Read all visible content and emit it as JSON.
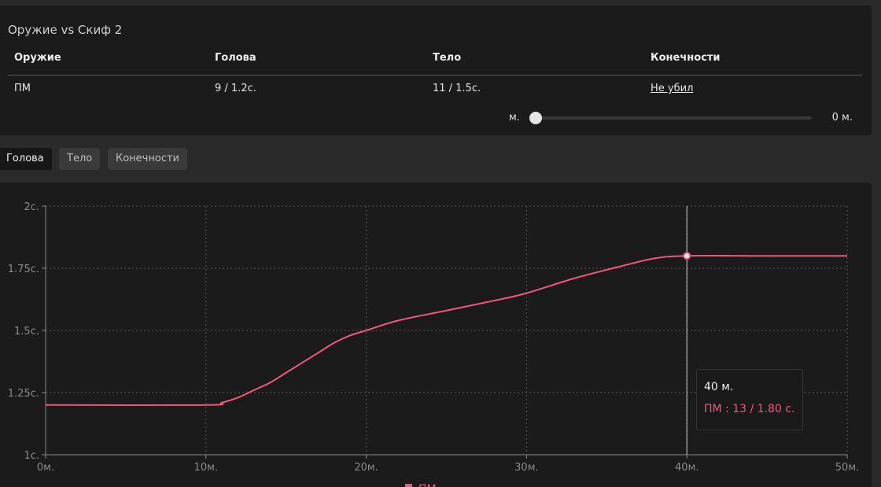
{
  "card": {
    "title": "Оружие vs Скиф 2",
    "headers": [
      "Оружие",
      "Голова",
      "Тело",
      "Конечности"
    ],
    "row": {
      "weapon": "ПМ",
      "head": "9 / 1.2с.",
      "body": "11 / 1.5с.",
      "limbs": "Не убил"
    },
    "slider": {
      "unit": "м.",
      "value_text": "0 м.",
      "value": 0
    }
  },
  "tabs": [
    {
      "label": "Голова",
      "active": true
    },
    {
      "label": "Тело",
      "active": false
    },
    {
      "label": "Конечности",
      "active": false
    }
  ],
  "colors": {
    "series": "#f0587a",
    "grid": "#555555",
    "axis": "#8a8a8a"
  },
  "tooltip": {
    "title": "40 м.",
    "line": "ПМ : 13 / 1.80 с."
  },
  "chart_data": {
    "type": "line",
    "x": [
      0,
      10,
      11,
      12,
      13,
      14,
      15,
      16,
      17,
      18,
      19,
      20,
      22,
      25,
      28,
      30,
      33,
      36,
      38,
      40,
      45,
      50
    ],
    "series": [
      {
        "name": "ПМ",
        "values": [
          1.2,
          1.2,
          1.21,
          1.23,
          1.26,
          1.29,
          1.33,
          1.37,
          1.41,
          1.45,
          1.48,
          1.5,
          1.54,
          1.58,
          1.62,
          1.65,
          1.71,
          1.76,
          1.79,
          1.8,
          1.8,
          1.8
        ]
      }
    ],
    "x_ticks": [
      "0м.",
      "10м.",
      "20м.",
      "30м.",
      "40м.",
      "50м."
    ],
    "x_tick_values": [
      0,
      10,
      20,
      30,
      40,
      50
    ],
    "y_ticks": [
      "1с.",
      "1.25с.",
      "1.5с.",
      "1.75с.",
      "2с."
    ],
    "y_tick_values": [
      1,
      1.25,
      1.5,
      1.75,
      2
    ],
    "xlim": [
      0,
      50
    ],
    "ylim": [
      1,
      2
    ],
    "grid": true,
    "legend": "bottom-center",
    "highlight_x": 40
  }
}
